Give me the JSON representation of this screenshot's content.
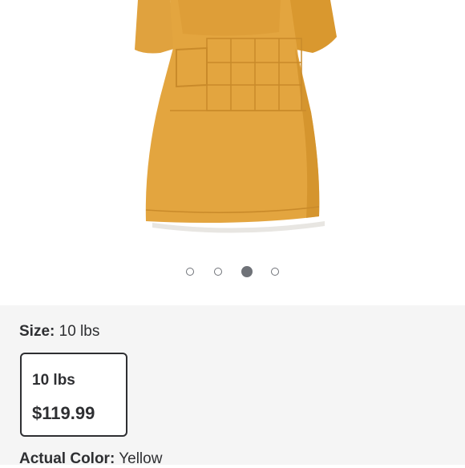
{
  "product": {
    "image_alt": "Yellow plush weighted wearable blanket robe",
    "image_color": "#E0A23E",
    "carousel": {
      "count": 4,
      "active_index": 2
    }
  },
  "size": {
    "label": "Size:",
    "selected_value": "10 lbs",
    "options": [
      {
        "size": "10 lbs",
        "price": "$119.99",
        "selected": true
      }
    ]
  },
  "color": {
    "label": "Actual Color:",
    "selected_value": "Yellow"
  }
}
